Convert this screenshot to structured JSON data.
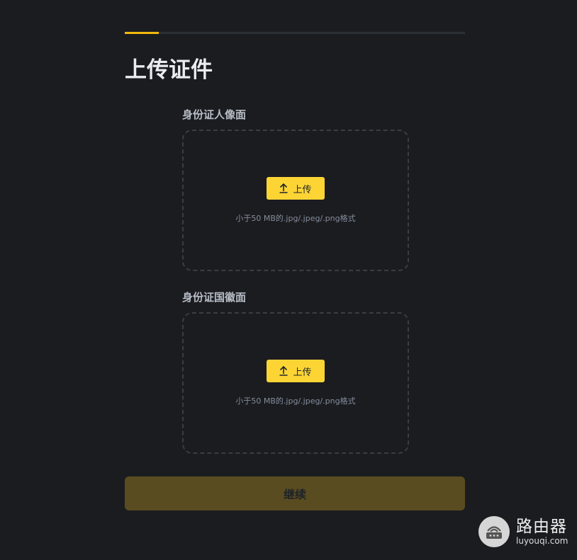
{
  "progress": {
    "fraction": 0.1
  },
  "page": {
    "title": "上传证件"
  },
  "front": {
    "label": "身份证人像面",
    "upload_label": "上传",
    "hint": "小于50 MB的.jpg/.jpeg/.png格式"
  },
  "back": {
    "label": "身份证国徽面",
    "upload_label": "上传",
    "hint": "小于50 MB的.jpg/.jpeg/.png格式"
  },
  "continue_label": "继续",
  "watermark": {
    "name": "路由器",
    "url": "luyouqi.com"
  },
  "colors": {
    "accent": "#fcd535",
    "progress": "#f0b90b",
    "background": "#1b1c20",
    "continue_disabled": "#594c20"
  }
}
